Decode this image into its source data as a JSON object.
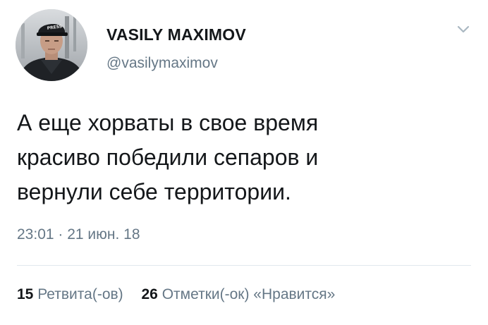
{
  "user": {
    "display_name": "VASILY MAXIMOV",
    "handle": "@vasilymaximov",
    "avatar_icon": "user-avatar-photo",
    "cap_text": "PRESS"
  },
  "menu": {
    "icon": "chevron-down-icon"
  },
  "tweet": {
    "text_lines": [
      "А еще хорваты в свое время",
      "красиво победили сепаров и",
      "вернули себе территории."
    ],
    "timestamp": "23:01 · 21 июн. 18"
  },
  "stats": {
    "retweets": {
      "count": "15",
      "label": "Ретвита(-ов)"
    },
    "likes": {
      "count": "26",
      "label": "Отметки(-ок) «Нравится»"
    }
  },
  "colors": {
    "text_primary": "#14171a",
    "text_secondary": "#657786",
    "divider": "#e1e8ed",
    "background": "#ffffff"
  }
}
